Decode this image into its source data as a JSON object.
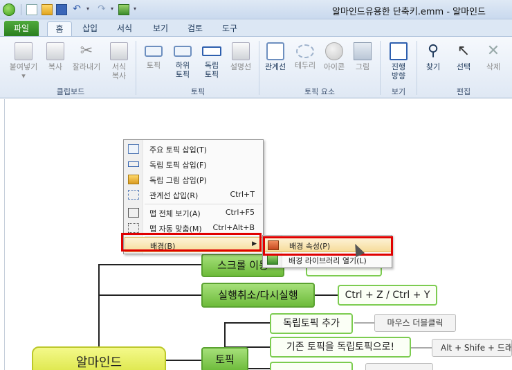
{
  "window": {
    "title": "알마인드유용한 단축키.emm - 알마인드"
  },
  "quick_access": {
    "icons": [
      "app-logo-icon",
      "new-document-icon",
      "open-folder-icon",
      "save-icon",
      "undo-icon",
      "redo-icon",
      "frame-icon"
    ]
  },
  "tabs": {
    "file": "파일",
    "home": "홈",
    "insert": "삽입",
    "format": "서식",
    "view": "보기",
    "review": "검토",
    "tools": "도구"
  },
  "ribbon": {
    "clipboard": {
      "paste": "붙여넣기",
      "copy": "복사",
      "cut": "잘라내기",
      "format_copy_1": "서식",
      "format_copy_2": "복사",
      "group": "클립보드"
    },
    "topic": {
      "topic": "토픽",
      "sub1": "하위",
      "sub2": "토픽",
      "free1": "독립",
      "free2": "토픽",
      "callout": "설명선",
      "group": "토픽"
    },
    "elements": {
      "relation": "관계선",
      "boundary": "테두리",
      "icon": "아이콘",
      "picture": "그림",
      "group": "토픽 요소"
    },
    "view": {
      "dir1": "진행",
      "dir2": "방향",
      "group": "보기"
    },
    "edit": {
      "find": "찾기",
      "select": "선택",
      "delete": "삭제",
      "group": "편집"
    }
  },
  "context_menu": {
    "items": [
      {
        "label": "주요 토픽 삽입(T)",
        "key": ""
      },
      {
        "label": "독립 토픽 삽입(F)",
        "key": ""
      },
      {
        "label": "독립 그림 삽입(P)",
        "key": ""
      },
      {
        "label": "관계선 삽입(R)",
        "key": "Ctrl+T"
      },
      {
        "label": "맵 전체 보기(A)",
        "key": "Ctrl+F5"
      },
      {
        "label": "맵 자동 맞춤(M)",
        "key": "Ctrl+Alt+B"
      },
      {
        "label": "배경(B)",
        "key": ""
      }
    ]
  },
  "submenu": {
    "items": [
      {
        "label": "배경 속성(P)"
      },
      {
        "label": "배경 라이브러리 열기(L)"
      }
    ]
  },
  "mindmap": {
    "root": "알마인드",
    "scroll": "스크롤 이동",
    "undo_redo": "실행취소/다시실행",
    "undo_redo_key": "Ctrl + Z / Ctrl + Y",
    "topic": "토픽",
    "free_topic_add": "독립토픽 추가",
    "double_click": "마우스 더블클릭",
    "to_free_topic": "기존 토픽을 독립토픽으로!",
    "alt_drag": "Alt + Shife + 드래"
  }
}
